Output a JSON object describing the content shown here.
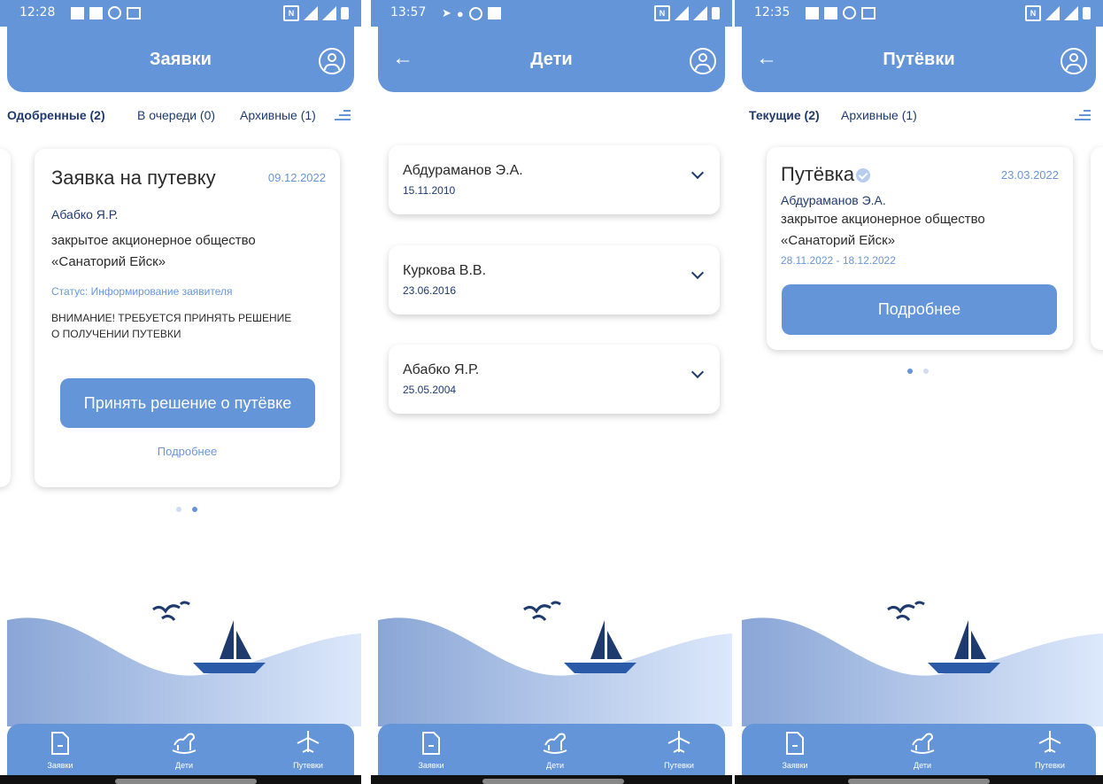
{
  "colors": {
    "primary": "#6495d9",
    "dark_text": "#1f3a6e",
    "accent_text": "#6a96d6"
  },
  "screen1": {
    "status_time": "12:28",
    "title": "Заявки",
    "tabs": [
      "Одобренные (2)",
      "В очереди (0)",
      "Архивные (1)"
    ],
    "card": {
      "title": "Заявка на путевку",
      "date": "09.12.2022",
      "name": "Абабко Я.Р.",
      "org_line1": "закрытое акционерное общество",
      "org_line2": "«Санаторий Ейск»",
      "status": "Статус: Информирование заявителя",
      "warning_line1": "ВНИМАНИЕ! ТРЕБУЕТСЯ ПРИНЯТЬ РЕШЕНИЕ",
      "warning_line2": "О ПОЛУЧЕНИИ ПУТЕВКИ",
      "button": "Принять решение о путёвке",
      "link": "Подробнее"
    },
    "pager": {
      "pages": 2,
      "active": 2
    }
  },
  "screen2": {
    "status_time": "13:57",
    "title": "Дети",
    "children": [
      {
        "name": "Абдураманов Э.А.",
        "birth": "15.11.2010"
      },
      {
        "name": "Куркова В.В.",
        "birth": "23.06.2016"
      },
      {
        "name": "Абабко Я.Р.",
        "birth": "25.05.2004"
      }
    ]
  },
  "screen3": {
    "status_time": "12:35",
    "title": "Путёвки",
    "tabs": [
      "Текущие (2)",
      "Архивные (1)"
    ],
    "card": {
      "title": "Путёвка",
      "date": "23.03.2022",
      "name": "Абдураманов Э.А.",
      "org_line1": "закрытое акционерное общество",
      "org_line2": "«Санаторий Ейск»",
      "period": "28.11.2022 - 18.12.2022",
      "button": "Подробнее"
    },
    "pager": {
      "pages": 2,
      "active": 1
    }
  },
  "nav": {
    "requests": "Заявки",
    "children": "Дети",
    "vouchers": "Путевки"
  },
  "icons": [
    "back-arrow-icon",
    "profile-icon",
    "filter-icon",
    "chevron-down-icon",
    "verified-icon",
    "document-icon",
    "rocking-horse-icon",
    "airplane-icon",
    "seagulls-icon",
    "sailboat-icon"
  ]
}
